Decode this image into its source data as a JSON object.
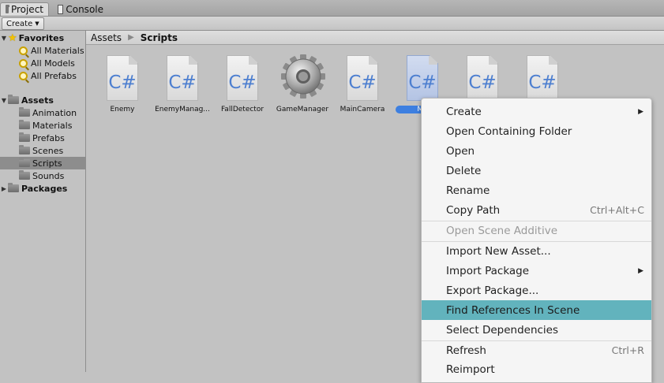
{
  "tabs": {
    "project": "Project",
    "console": "Console"
  },
  "toolbar": {
    "create": "Create"
  },
  "tree": {
    "favorites": "Favorites",
    "fav_items": [
      "All Materials",
      "All Models",
      "All Prefabs"
    ],
    "assets": "Assets",
    "asset_folders": [
      "Animation",
      "Materials",
      "Prefabs",
      "Scenes",
      "Scripts",
      "Sounds"
    ],
    "packages": "Packages",
    "selected": "Scripts"
  },
  "breadcrumb": {
    "root": "Assets",
    "current": "Scripts"
  },
  "assets": [
    {
      "name": "Enemy",
      "kind": "script",
      "glyph": "C#"
    },
    {
      "name": "EnemyManag...",
      "kind": "script",
      "glyph": "C#"
    },
    {
      "name": "FallDetector",
      "kind": "script",
      "glyph": "C#"
    },
    {
      "name": "GameManager",
      "kind": "gear-icon"
    },
    {
      "name": "MainCamera",
      "kind": "script",
      "glyph": "C#"
    },
    {
      "name": "Me",
      "kind": "script",
      "glyph": "C#",
      "selected": true
    },
    {
      "name": "",
      "kind": "script",
      "glyph": "C#"
    },
    {
      "name": "",
      "kind": "script",
      "glyph": "C#"
    }
  ],
  "menu": {
    "items": [
      {
        "label": "Create",
        "submenu": true
      },
      {
        "label": "Open Containing Folder"
      },
      {
        "label": "Open"
      },
      {
        "label": "Delete"
      },
      {
        "label": "Rename"
      },
      {
        "label": "Copy Path",
        "shortcut": "Ctrl+Alt+C"
      },
      {
        "label": "Open Scene Additive",
        "disabled": true
      },
      {
        "label": "Import New Asset..."
      },
      {
        "label": "Import Package",
        "submenu": true
      },
      {
        "label": "Export Package..."
      },
      {
        "label": "Find References In Scene",
        "highlighted": true
      },
      {
        "label": "Select Dependencies"
      },
      {
        "label": "Refresh",
        "shortcut": "Ctrl+R"
      },
      {
        "label": "Reimport"
      }
    ]
  },
  "colors": {
    "highlight": "#62b3bd",
    "selection": "#3d7fe0",
    "csharp": "#4d7fd0"
  }
}
